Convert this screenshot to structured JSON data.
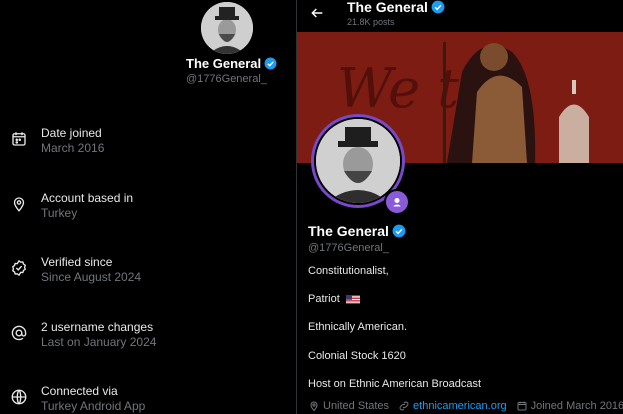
{
  "left_panel": {
    "name": "The General",
    "handle": "@1776General_",
    "rows": [
      {
        "title": "Date joined",
        "sub": "March 2016",
        "icon": "calendar-icon"
      },
      {
        "title": "Account based in",
        "sub": "Turkey",
        "icon": "location-pin-icon"
      },
      {
        "title": "Verified since",
        "sub": "Since August 2024",
        "icon": "verified-check-icon"
      },
      {
        "title": "2 username changes",
        "sub": "Last on January 2024",
        "icon": "at-sign-icon"
      },
      {
        "title": "Connected via",
        "sub": "Turkey Android App",
        "icon": "globe-icon"
      }
    ]
  },
  "profile": {
    "header_name": "The General",
    "post_count": "21.8K posts",
    "name": "The General",
    "handle": "@1776General_",
    "bio": [
      "Constitutionalist,",
      "Patriot",
      "Ethnically American.",
      "Colonial Stock 1620",
      "Host on Ethnic American Broadcast"
    ],
    "location": "United States",
    "website": "ethnicamerican.org",
    "joined": "Joined March 2016"
  },
  "colors": {
    "verified": "#1d9bf0",
    "banner": "#7a1a14",
    "avatar_ring": "#7848c7"
  }
}
